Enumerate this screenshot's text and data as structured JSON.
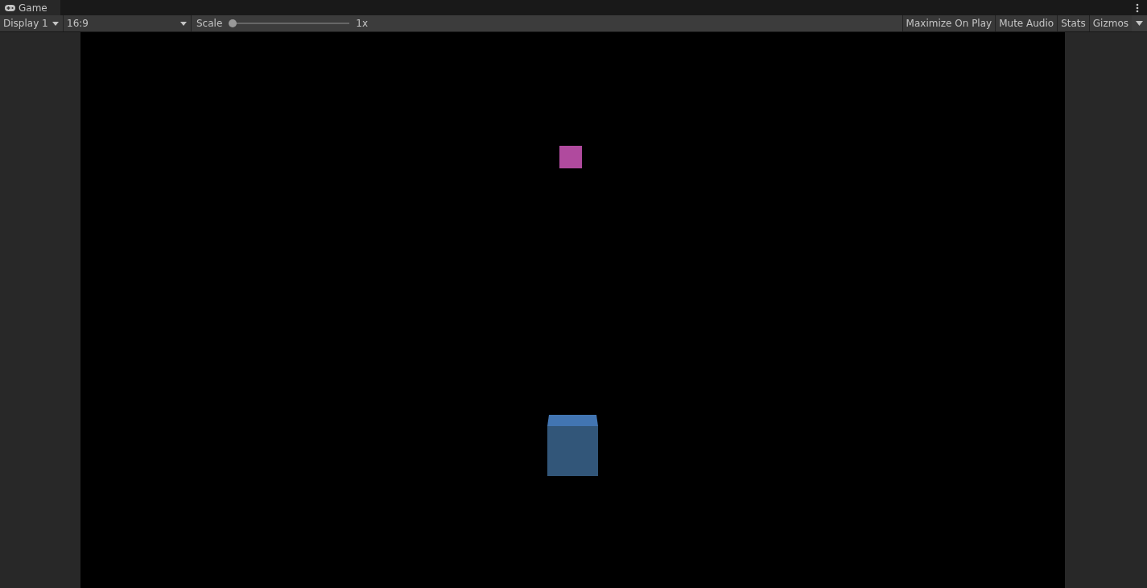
{
  "tab": {
    "label": "Game"
  },
  "toolbar": {
    "display": "Display 1",
    "aspect": "16:9",
    "scale": {
      "label": "Scale",
      "level": 0,
      "reading": "1x"
    },
    "buttons": [
      {
        "label": "Maximize On Play"
      },
      {
        "label": "Mute Audio"
      },
      {
        "label": "Stats"
      },
      {
        "label": "Gizmos"
      }
    ]
  }
}
